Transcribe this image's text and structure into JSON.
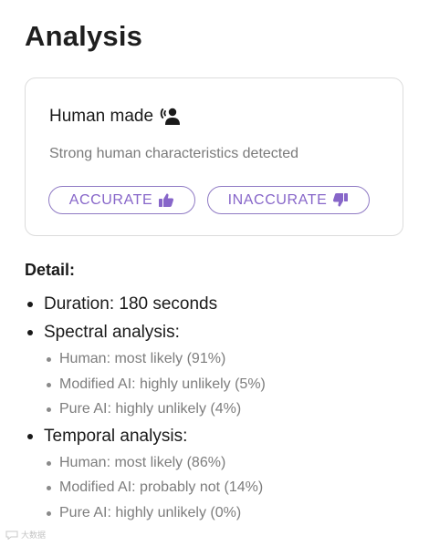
{
  "page": {
    "title": "Analysis"
  },
  "result": {
    "verdict": "Human made",
    "verdict_icon": "person-voice-icon",
    "description": "Strong human characteristics detected",
    "buttons": {
      "accurate": {
        "label": "ACCURATE",
        "icon": "thumbs-up-icon"
      },
      "inaccurate": {
        "label": "INACCURATE",
        "icon": "thumbs-down-icon"
      }
    }
  },
  "detail": {
    "heading": "Detail:",
    "duration": "Duration: 180 seconds",
    "spectral": {
      "label": "Spectral analysis:",
      "items": [
        "Human: most likely (91%)",
        "Modified AI: highly unlikely (5%)",
        "Pure AI: highly unlikely (4%)"
      ]
    },
    "temporal": {
      "label": "Temporal analysis:",
      "items": [
        "Human: most likely (86%)",
        "Modified AI: probably not (14%)",
        "Pure AI: highly unlikely (0%)"
      ]
    }
  },
  "colors": {
    "accent": "#8766c9",
    "accent_border": "#8f7ac4",
    "muted_text": "#7d7d7d",
    "card_border": "#dcdcdc"
  },
  "watermark": {
    "text": "大数据",
    "icon": "chat-bubble-icon"
  }
}
